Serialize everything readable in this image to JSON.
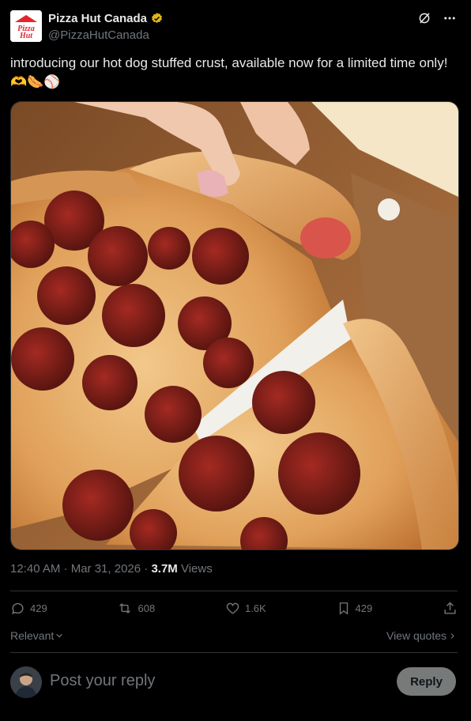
{
  "author": {
    "name": "Pizza Hut Canada",
    "handle": "@PizzaHutCanada",
    "logo_text_top": "Pizza",
    "logo_text_bottom": "Hut",
    "verified_color": "#e2b719"
  },
  "header_icons": [
    "grok-icon",
    "more-icon"
  ],
  "tweet": {
    "text": "introducing our hot dog stuffed crust, available now for a limited time only! 🫶🌭⚾"
  },
  "meta": {
    "time": "12:40 AM · Mar 31, 2026 · ",
    "views_count": "3.7M",
    "views_label": " Views"
  },
  "actions": {
    "replies": "429",
    "reposts": "608",
    "likes": "1.6K",
    "bookmarks": "429"
  },
  "sort": {
    "label": "Relevant",
    "view_quotes": "View quotes"
  },
  "composer": {
    "placeholder": "Post your reply",
    "button": "Reply"
  },
  "colors": {
    "background": "#000000",
    "text": "#e7e9ea",
    "muted": "#71767b",
    "divider": "#2f3336",
    "reply_button": "#787a7a"
  }
}
